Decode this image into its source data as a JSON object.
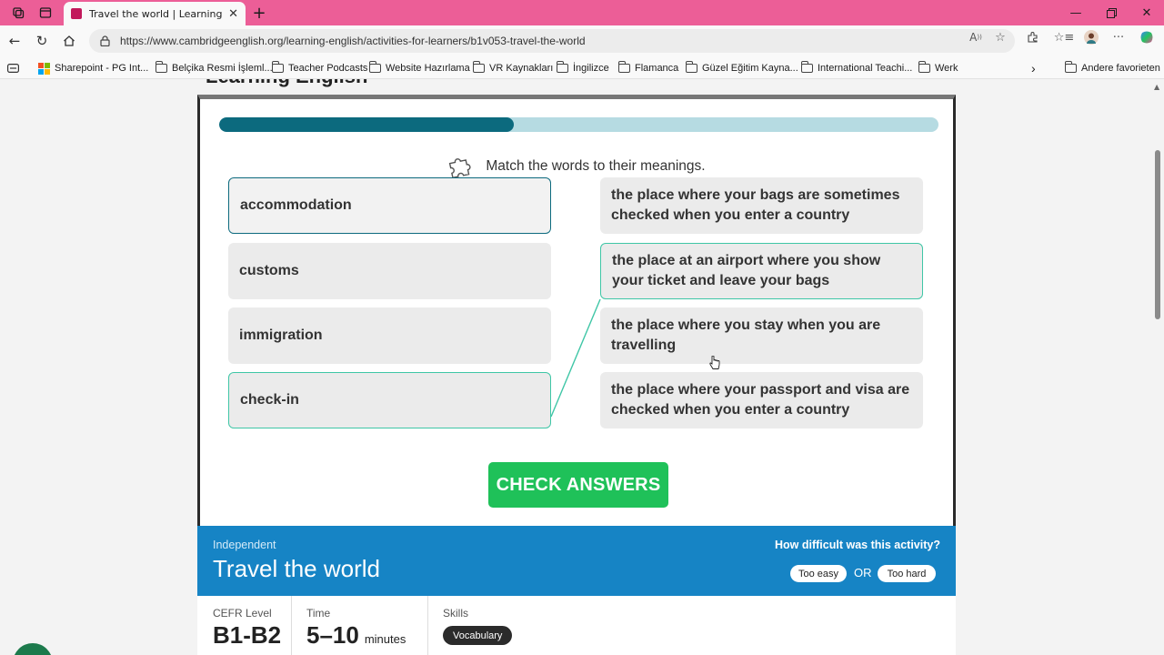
{
  "browser": {
    "tab_title": "Travel the world | Learning English",
    "url": "https://www.cambridgeenglish.org/learning-english/activities-for-learners/b1v053-travel-the-world",
    "accent_color": "#ec5e97"
  },
  "favorites": [
    {
      "label": "Sharepoint - PG Int...",
      "icon": "windows-logo-icon"
    },
    {
      "label": "Belçika Resmi İşleml...",
      "icon": "folder-icon"
    },
    {
      "label": "Teacher Podcasts",
      "icon": "folder-icon"
    },
    {
      "label": "Website Hazırlama",
      "icon": "folder-icon"
    },
    {
      "label": "VR Kaynakları",
      "icon": "folder-icon"
    },
    {
      "label": "İngilizce",
      "icon": "folder-icon"
    },
    {
      "label": "Flamanca",
      "icon": "folder-icon"
    },
    {
      "label": "Güzel Eğitim Kayna...",
      "icon": "folder-icon"
    },
    {
      "label": "International Teachi...",
      "icon": "folder-icon"
    },
    {
      "label": "Werk",
      "icon": "folder-icon"
    },
    {
      "label": "Andere favorieten",
      "icon": "folder-icon"
    }
  ],
  "page": {
    "heading_peek": "Learning English"
  },
  "activity": {
    "progress_fraction": 0.41,
    "instruction": "Match the words to their meanings.",
    "words": [
      "accommodation",
      "customs",
      "immigration",
      "check-in"
    ],
    "meanings": [
      "the place where your bags are sometimes checked when you enter a country",
      "the place at an airport where you show your ticket and leave your bags",
      "the place where you stay when you are travelling",
      "the place where your passport and visa are checked when you enter a country"
    ],
    "check_button": "CHECK ANSWERS"
  },
  "info": {
    "level_tag": "Independent",
    "title": "Travel the world",
    "difficulty_question": "How difficult was this activity?",
    "too_easy": "Too easy",
    "or": "OR",
    "too_hard": "Too hard"
  },
  "meta": {
    "cefr_label": "CEFR Level",
    "cefr_value": "B1-B2",
    "time_label": "Time",
    "time_value": "5–10",
    "time_unit": "minutes",
    "skills_label": "Skills",
    "skill": "Vocabulary"
  }
}
